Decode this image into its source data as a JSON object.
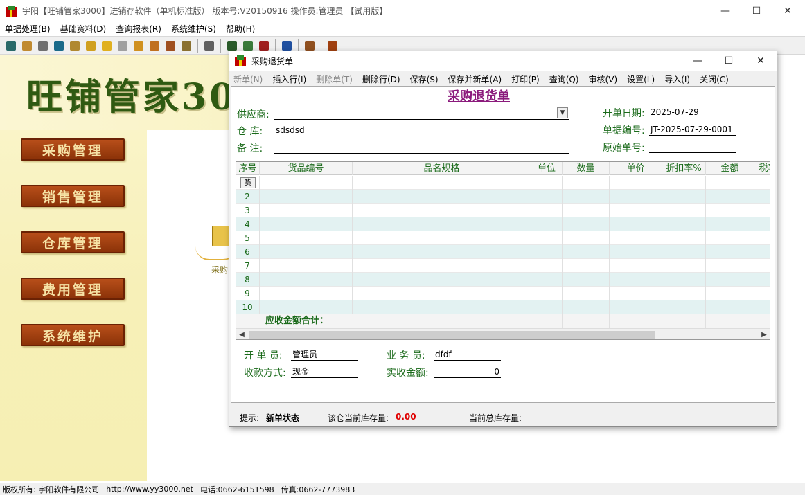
{
  "main_window": {
    "title": "宇阳【旺铺管家3000】进销存软件（单机标准版）   版本号:V20150916   操作员:管理员  【试用版】",
    "controls": {
      "minimize": "—",
      "maximize": "☐",
      "close": "✕"
    }
  },
  "menubar": [
    {
      "label": "单据处理(B)"
    },
    {
      "label": "基础资料(D)"
    },
    {
      "label": "查询报表(R)"
    },
    {
      "label": "系统维护(S)"
    },
    {
      "label": "帮助(H)"
    }
  ],
  "toolbar": {
    "buttons": [
      {
        "icon": "disk-icon",
        "color": "#2a6a6a"
      },
      {
        "icon": "edit-icon",
        "color": "#c08a30"
      },
      {
        "icon": "database-icon",
        "color": "#707070"
      },
      {
        "icon": "drum-icon",
        "color": "#1a6a8a"
      },
      {
        "icon": "stack-icon",
        "color": "#b08830"
      },
      {
        "icon": "box-icon",
        "color": "#d0a020"
      },
      {
        "icon": "package-icon",
        "color": "#e0b020"
      },
      {
        "icon": "note-icon",
        "color": "#a0a0a0"
      },
      {
        "icon": "bar-chart-icon",
        "color": "#d09020"
      },
      {
        "icon": "bar-chart-2-icon",
        "color": "#c07020"
      },
      {
        "icon": "bar-chart-3-icon",
        "color": "#a05020"
      },
      {
        "icon": "tools-icon",
        "color": "#8a7030"
      },
      {
        "icon": "user-icon",
        "color": "#606060"
      },
      {
        "icon": "calculator-icon",
        "color": "#2a5a2a"
      },
      {
        "icon": "refresh-icon",
        "color": "#3a7a3a"
      },
      {
        "icon": "grid-icon",
        "color": "#a02020"
      },
      {
        "icon": "help-icon",
        "color": "#2050a0"
      },
      {
        "icon": "calc-icon",
        "color": "#905020"
      },
      {
        "icon": "exit-icon",
        "color": "#a04010"
      }
    ]
  },
  "left_panel": {
    "banner": "旺铺管家30",
    "nav": [
      {
        "label": "采购管理"
      },
      {
        "label": "销售管理"
      },
      {
        "label": "仓库管理"
      },
      {
        "label": "费用管理"
      },
      {
        "label": "系统维护"
      }
    ],
    "center_label": "采购"
  },
  "statusbar": {
    "copyright": "版权所有: 宇阳软件有限公司",
    "url": "http://www.yy3000.net",
    "phone": "电话:0662-6151598",
    "fax": "传真:0662-7773983"
  },
  "dialog": {
    "title": "采购退货单",
    "controls": {
      "minimize": "—",
      "maximize": "☐",
      "close": "✕"
    },
    "menu": [
      {
        "label": "新单(N)",
        "disabled": true
      },
      {
        "label": "插入行(I)",
        "disabled": false
      },
      {
        "label": "删除单(T)",
        "disabled": true
      },
      {
        "label": "删除行(D)",
        "disabled": false
      },
      {
        "label": "保存(S)",
        "disabled": false
      },
      {
        "label": "保存并新单(A)",
        "disabled": false
      },
      {
        "label": "打印(P)",
        "disabled": false
      },
      {
        "label": "查询(Q)",
        "disabled": false
      },
      {
        "label": "审核(V)",
        "disabled": false
      },
      {
        "label": "设置(L)",
        "disabled": false
      },
      {
        "label": "导入(I)",
        "disabled": false
      },
      {
        "label": "关闭(C)",
        "disabled": false
      }
    ],
    "doc_title": "采购退货单",
    "fields": {
      "supplier_label": "供应商:",
      "supplier_value": "",
      "warehouse_label": "仓    库:",
      "warehouse_value": "sdsdsd",
      "remark_label": "备    注:",
      "remark_value": "",
      "open_date_label": "开单日期:",
      "open_date_value": "2025-07-29",
      "doc_no_label": "单据编号:",
      "doc_no_value": "JT-2025-07-29-0001",
      "orig_no_label": "原始单号:",
      "orig_no_value": ""
    },
    "grid": {
      "columns": [
        "序号",
        "货品编号",
        "品名规格",
        "单位",
        "数量",
        "单价",
        "折扣率%",
        "金额",
        "税率"
      ],
      "first_row_button": "货",
      "row_numbers": [
        "2",
        "3",
        "4",
        "5",
        "6",
        "7",
        "8",
        "9",
        "10"
      ],
      "total_label": "应收金额合计："
    },
    "bottom": {
      "creator_label": "开 单 员:",
      "creator_value": "管理员",
      "salesman_label": "业 务 员:",
      "salesman_value": "dfdf",
      "payment_label": "收款方式:",
      "payment_value": "现金",
      "received_label": "实收金额:",
      "received_value": "0"
    },
    "status": {
      "hint_label": "提示:",
      "hint_value": "新单状态",
      "stock_label": "该仓当前库存量:",
      "stock_value": "0.00",
      "total_stock_label": "当前总库存量:"
    }
  }
}
